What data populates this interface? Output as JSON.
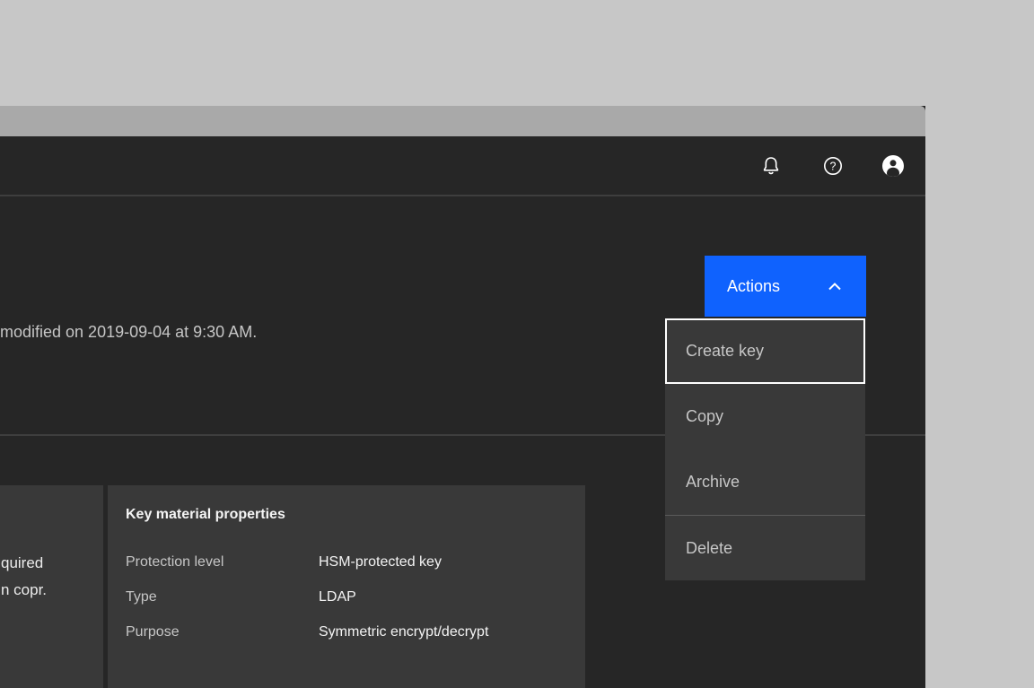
{
  "colors": {
    "accent_blue": "#0f62fe",
    "canvas_background": "#c7c7c7",
    "titlebar_gray": "#a9a9a9",
    "window_background": "#262626",
    "surface_gray": "#393939",
    "divider_gray": "#3e3e3e",
    "menu_divider_gray": "#5a5a5a",
    "text_primary": "#f4f4f4",
    "text_secondary": "#c6c6c6",
    "focus_outline": "#ffffff"
  },
  "header": {
    "icons": [
      {
        "name": "notifications-bell"
      },
      {
        "name": "help"
      },
      {
        "name": "user-avatar"
      }
    ]
  },
  "page_header": {
    "modified_text": "modified on 2019-09-04 at 9:30 AM.",
    "actions_button": {
      "label": "Actions",
      "state": "open"
    }
  },
  "actions_menu": {
    "items": [
      {
        "label": "Create key",
        "focused": true
      },
      {
        "label": "Copy",
        "focused": false
      },
      {
        "label": "Archive",
        "focused": false
      },
      {
        "label": "Delete",
        "focused": false,
        "divider_above": true
      }
    ]
  },
  "left_card_fragment": {
    "line1": "quired",
    "line2": "n copr."
  },
  "key_material_card": {
    "title": "Key material properties",
    "rows": [
      {
        "label": "Protection level",
        "value": "HSM-protected key"
      },
      {
        "label": "Type",
        "value": "LDAP"
      },
      {
        "label": "Purpose",
        "value": "Symmetric encrypt/decrypt"
      }
    ]
  }
}
